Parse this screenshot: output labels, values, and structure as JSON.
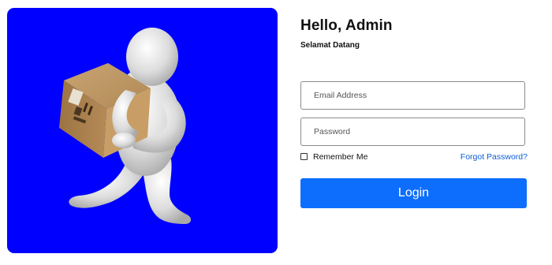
{
  "header": {
    "title": "Hello, Admin",
    "subtitle": "Selamat Datang"
  },
  "form": {
    "email_placeholder": "Email Address",
    "password_placeholder": "Password",
    "remember_label": "Remember Me",
    "forgot_label": "Forgot Password?",
    "login_label": "Login"
  },
  "illustration": {
    "name": "delivery-man-carrying-box-illustration",
    "background": "#0000ff"
  },
  "colors": {
    "primary": "#0d6efd",
    "link": "#0b5ed7"
  }
}
